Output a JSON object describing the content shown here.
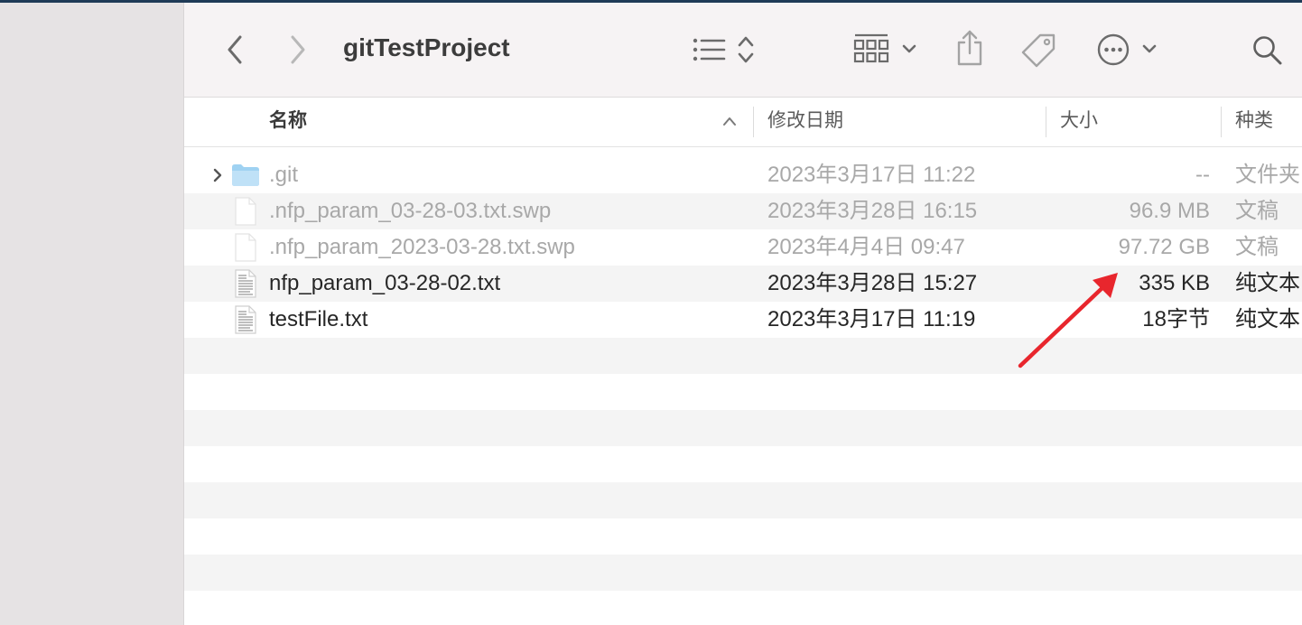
{
  "window": {
    "title": "gitTestProject"
  },
  "toolbar": {
    "back_icon": "chevron-left-icon",
    "forward_icon": "chevron-right-icon",
    "view_icon": "list-view-icon",
    "group_icon": "grid-group-icon",
    "share_icon": "share-icon",
    "tag_icon": "tag-icon",
    "more_icon": "ellipsis-circle-icon",
    "search_icon": "search-icon"
  },
  "columns": {
    "name": "名称",
    "date": "修改日期",
    "size": "大小",
    "kind": "种类",
    "sort_icon": "chevron-up-icon"
  },
  "files": [
    {
      "name": ".git",
      "date": "2023年3月17日 11:22",
      "size": "--",
      "kind": "文件夹",
      "icon": "folder-icon",
      "dimmed": true,
      "expandable": true
    },
    {
      "name": ".nfp_param_03-28-03.txt.swp",
      "date": "2023年3月28日 16:15",
      "size": "96.9 MB",
      "kind": "文稿",
      "icon": "document-icon",
      "dimmed": true
    },
    {
      "name": ".nfp_param_2023-03-28.txt.swp",
      "date": "2023年4月4日 09:47",
      "size": "97.72 GB",
      "kind": "文稿",
      "icon": "document-icon",
      "dimmed": true
    },
    {
      "name": "nfp_param_03-28-02.txt",
      "date": "2023年3月28日 15:27",
      "size": "335 KB",
      "kind": "纯文本",
      "icon": "text-file-icon",
      "dimmed": false
    },
    {
      "name": "testFile.txt",
      "date": "2023年3月17日 11:19",
      "size": "18字节",
      "kind": "纯文本",
      "icon": "text-file-icon",
      "dimmed": false
    }
  ],
  "annotation": {
    "color": "#e8262d",
    "icon": "red-arrow-annotation"
  }
}
